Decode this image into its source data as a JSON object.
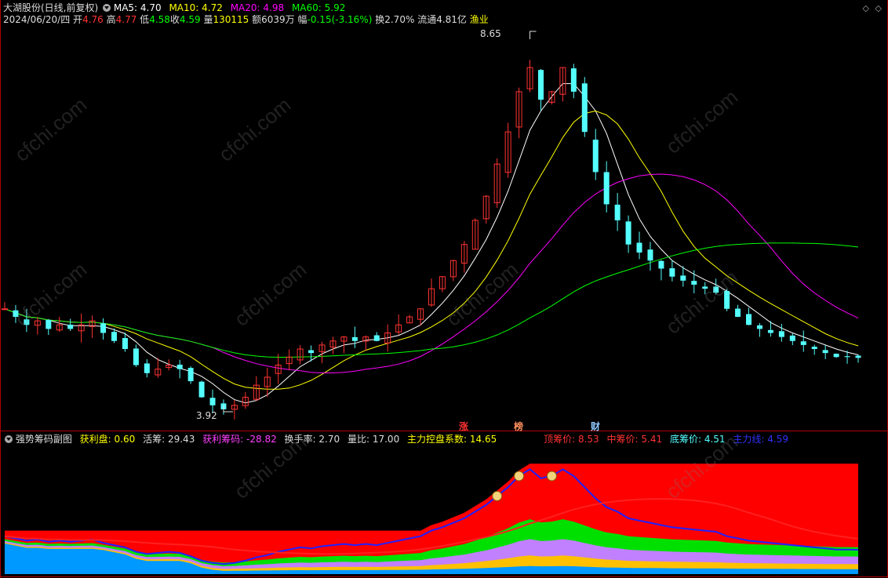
{
  "main": {
    "stock_title": "大湖股份(日线,前复权)",
    "ma5_label": "MA5: 4.70",
    "ma10_label": "MA10: 4.72",
    "ma20_label": "MA20: 4.98",
    "ma60_label": "MA60: 5.92",
    "date": "2024/06/20/四",
    "open_label": "开",
    "open_value": "4.76",
    "high_label": "高",
    "high_value": "4.77",
    "low_label": "低",
    "low_value": "4.58",
    "close_label": "收",
    "close_value": "4.59",
    "volume_label": "量",
    "volume_value": "130115",
    "amount_label": "额",
    "amount_value": "6039万",
    "change_label": "幅",
    "change_value": "-0.15(-3.16%)",
    "turnover": "换2.70%",
    "float_cap": "流通4.81亿",
    "sector": "渔业",
    "high_marker": "8.65",
    "low_marker": "3.92",
    "tag_zhang": "涨",
    "tag_bang": "榜",
    "tag_cai": "财"
  },
  "sub": {
    "indicator_name": "强势筹码副图",
    "profit_label": "获利盘:",
    "profit_value": "0.60",
    "active_label": "活筹:",
    "active_value": "29.43",
    "profit_chip_label": "获利筹码:",
    "profit_chip_value": "-28.82",
    "turnover_label": "换手率:",
    "turnover_value": "2.70",
    "volume_ratio_label": "量比:",
    "volume_ratio_value": "17.00",
    "control_label": "主力控盘系数:",
    "control_value": "14.65",
    "top_price_label": "顶筹价:",
    "top_price_value": "8.53",
    "mid_price_label": "中筹价:",
    "mid_price_value": "5.41",
    "bottom_price_label": "底筹价:",
    "bottom_price_value": "4.51",
    "main_line_label": "主力线:",
    "main_line_value": "4.59"
  },
  "watermark": "cfchi.com",
  "colors": {
    "up": "#ff3232",
    "down": "#54ffff",
    "ma5": "#ffffff",
    "ma10": "#ffff00",
    "ma20": "#ff00ff",
    "ma60": "#00ff00",
    "text": "#dddddd",
    "band_red": "#ff0000",
    "band_green": "#00e000",
    "band_violet": "#c080ff",
    "band_yellow": "#ffc000",
    "band_blue": "#0099ff",
    "main_line": "#2020ff"
  },
  "chart_data": {
    "type": "candlestick",
    "price_range": [
      3.92,
      8.65
    ],
    "close_series": [
      5.2,
      5.1,
      5.0,
      5.05,
      4.95,
      5.0,
      4.95,
      5.0,
      5.05,
      4.9,
      4.8,
      4.7,
      4.5,
      4.4,
      4.45,
      4.5,
      4.45,
      4.3,
      4.1,
      4.0,
      3.95,
      4.0,
      4.1,
      4.25,
      4.35,
      4.5,
      4.6,
      4.7,
      4.65,
      4.75,
      4.8,
      4.85,
      4.8,
      4.85,
      4.8,
      4.9,
      5.0,
      5.1,
      5.2,
      5.45,
      5.6,
      5.8,
      6.0,
      6.3,
      6.6,
      7.0,
      7.4,
      7.9,
      8.2,
      7.8,
      7.9,
      8.2,
      7.9,
      7.4,
      6.9,
      6.5,
      6.3,
      6.0,
      5.9,
      5.8,
      5.7,
      5.6,
      5.55,
      5.5,
      5.45,
      5.4,
      5.2,
      5.1,
      5.0,
      4.95,
      4.9,
      4.85,
      4.8,
      4.75,
      4.7,
      4.65,
      4.6,
      4.6,
      4.59
    ]
  }
}
